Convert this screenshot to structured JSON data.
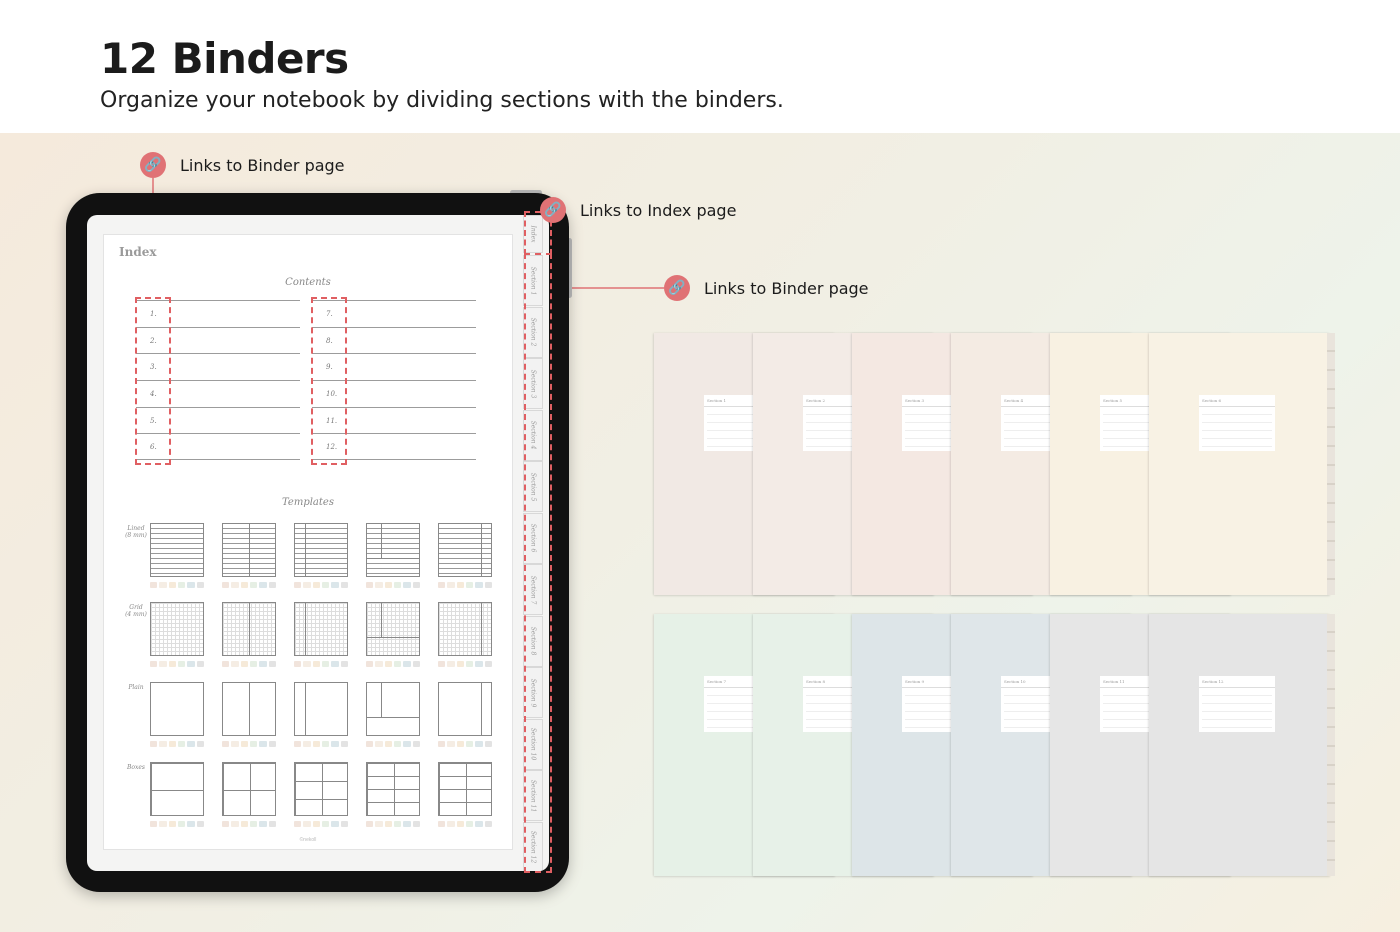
{
  "header": {
    "title": "12 Binders",
    "subtitle": "Organize your notebook by dividing sections with the binders."
  },
  "callouts": {
    "binder_top": "Links to Binder page",
    "index": "Links to Index page",
    "binder_right": "Links to Binder page",
    "icon": "link-icon"
  },
  "notebook": {
    "index_title": "Index",
    "contents_title": "Contents",
    "templates_title": "Templates",
    "toc_left": [
      "1.",
      "2.",
      "3.",
      "4.",
      "5.",
      "6."
    ],
    "toc_right": [
      "7.",
      "8.",
      "9.",
      "10.",
      "11.",
      "12."
    ],
    "template_rows": [
      "Lined\n(8 mm)",
      "Grid\n(4 mm)",
      "Plain",
      "Boxes"
    ],
    "tabs": [
      "Index",
      "Section 1",
      "Section 2",
      "Section 3",
      "Section 4",
      "Section 5",
      "Section 6",
      "Section 7",
      "Section 8",
      "Section 9",
      "Section 10",
      "Section 11",
      "Section 12"
    ],
    "footer": "©nekoll"
  },
  "binders_row1": [
    {
      "label": "Section 1",
      "color": "#f1e9e4"
    },
    {
      "label": "Section 2",
      "color": "#f3ebe6"
    },
    {
      "label": "Section 3",
      "color": "#f4e8e2"
    },
    {
      "label": "Section 4",
      "color": "#f4ebe3"
    },
    {
      "label": "Section 5",
      "color": "#f8f1e2"
    },
    {
      "label": "Section 6",
      "color": "#f8f2e4"
    }
  ],
  "binders_row2": [
    {
      "label": "Section 7",
      "color": "#e6f1e7"
    },
    {
      "label": "Section 8",
      "color": "#e7f1e8"
    },
    {
      "label": "Section 9",
      "color": "#dde5e8"
    },
    {
      "label": "Section 10",
      "color": "#dfe6e9"
    },
    {
      "label": "Section 11",
      "color": "#e6e6e6"
    },
    {
      "label": "Section 12",
      "color": "#e5e5e5"
    }
  ],
  "swatch_colors": [
    "#f1e4dc",
    "#f5ede4",
    "#f6ead9",
    "#e6efe4",
    "#dbe6ea",
    "#e3e3e3"
  ],
  "accent_color": "#e07275"
}
